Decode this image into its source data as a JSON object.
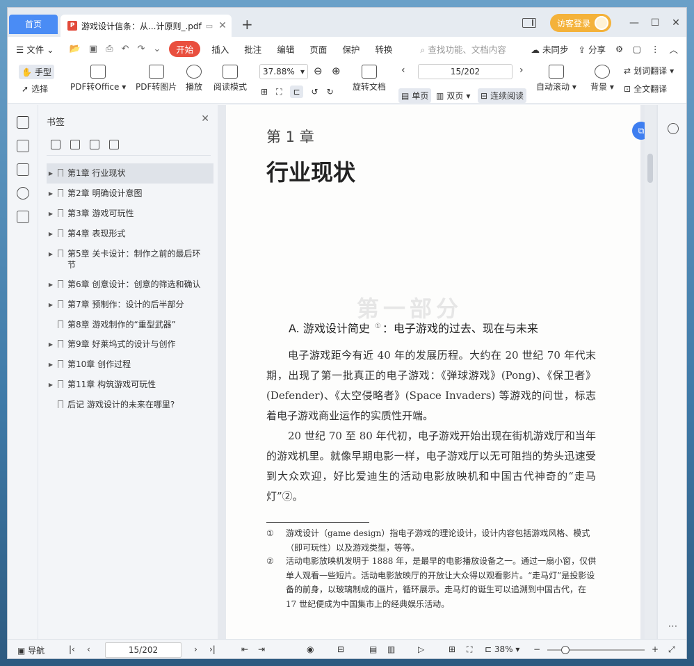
{
  "titlebar": {
    "home_tab": "首页",
    "doc_tab": "游戏设计信条：从...计原则_.pdf",
    "new_tab": "+",
    "login_label": "访客登录",
    "minimize": "—",
    "maximize": "☐",
    "close": "✕"
  },
  "menubar": {
    "file": "文件",
    "start": "开始",
    "items": [
      "插入",
      "批注",
      "编辑",
      "页面",
      "保护",
      "转换"
    ],
    "search_placeholder": "查找功能、文档内容",
    "sync": "未同步",
    "share": "分享"
  },
  "toolbar": {
    "hand": "手型",
    "select": "选择",
    "pdf_to_office": "PDF转Office",
    "pdf_to_image": "PDF转图片",
    "play": "播放",
    "read_mode": "阅读模式",
    "zoom": "37.88%",
    "rotate": "旋转文档",
    "page_indicator": "15/202",
    "single_page": "单页",
    "double_page": "双页",
    "continuous": "连续阅读",
    "auto_scroll": "自动滚动",
    "background": "背景",
    "word_translate": "划词翻译",
    "full_translate": "全文翻译"
  },
  "bookmarks": {
    "title": "书签",
    "items": [
      {
        "label": "第1章  行业现状",
        "has_children": true
      },
      {
        "label": "第2章  明确设计意图",
        "has_children": true
      },
      {
        "label": "第3章  游戏可玩性",
        "has_children": true
      },
      {
        "label": "第4章  表现形式",
        "has_children": true
      },
      {
        "label": "第5章  关卡设计：制作之前的最后环节",
        "has_children": true
      },
      {
        "label": "第6章  创意设计：创意的筛选和确认",
        "has_children": true
      },
      {
        "label": "第7章  预制作：设计的后半部分",
        "has_children": true
      },
      {
        "label": "第8章  游戏制作的“重型武器”",
        "has_children": false
      },
      {
        "label": "第9章  好莱坞式的设计与创作",
        "has_children": true
      },
      {
        "label": "第10章  创作过程",
        "has_children": true
      },
      {
        "label": "第11章  构筑游戏可玩性",
        "has_children": true
      },
      {
        "label": "后记  游戏设计的未来在哪里?",
        "has_children": false
      }
    ]
  },
  "page": {
    "chapter_num": "第 1 章",
    "chapter_title": "行业现状",
    "ghost_text": "第一部分",
    "section_title": "A. 游戏设计简史",
    "section_sup": "①",
    "section_subtitle": "：电子游戏的过去、现在与未来",
    "para1": "电子游戏距今有近 40 年的发展历程。大约在 20 世纪 70 年代末期，出现了第一批真正的电子游戏：《弹球游戏》(Pong)、《保卫者》(Defender)、《太空侵略者》(Space Invaders) 等游戏的问世，标志着电子游戏商业运作的实质性开端。",
    "para2": "20 世纪 70 至 80 年代初，电子游戏开始出现在街机游戏厅和当年的游戏机里。就像早期电影一样，电子游戏厅以无可阻挡的势头迅速受到大众欢迎，好比爱迪生的活动电影放映机和中国古代神奇的“走马灯”②。",
    "footnotes": [
      {
        "num": "①",
        "text": "游戏设计（game design）指电子游戏的理论设计，设计内容包括游戏风格、模式（即可玩性）以及游戏类型，等等。"
      },
      {
        "num": "②",
        "text": "活动电影放映机发明于 1888 年，是最早的电影播放设备之一。通过一扇小窗，仅供单人观看一些短片。活动电影放映厅的开放让大众得以观看影片。“走马灯”是投影设备的前身，以玻璃制成的画片，循环展示。走马灯的诞生可以追溯到中国古代，在 17 世纪便成为中国集市上的经典娱乐活动。"
      }
    ]
  },
  "statusbar": {
    "nav": "导航",
    "page": "15/202",
    "zoom": "38%"
  },
  "colors": {
    "accent": "#4a8cf5",
    "start_red": "#e94f3f",
    "login_orange": "#f4b23a"
  }
}
